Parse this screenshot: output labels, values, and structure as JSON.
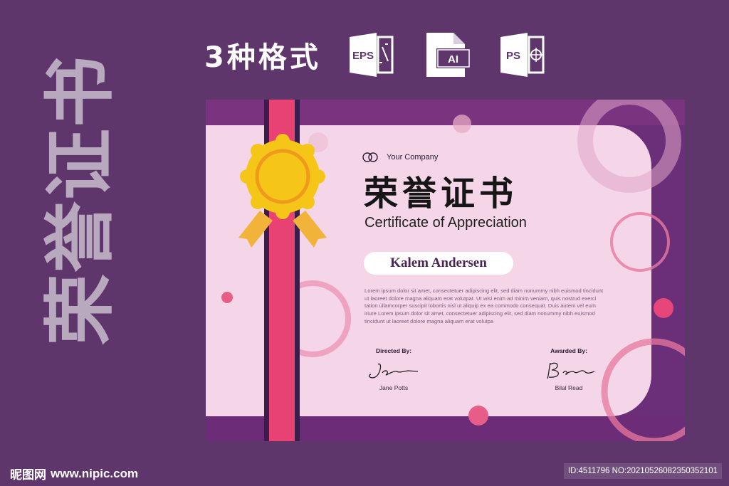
{
  "side_title_chars": [
    "荣",
    "誉",
    "证",
    "书"
  ],
  "formats": {
    "label": "3种格式",
    "icons": [
      {
        "name": "eps-file-icon",
        "text": "EPS"
      },
      {
        "name": "ai-file-icon",
        "text": "AI"
      },
      {
        "name": "ps-file-icon",
        "text": "PS"
      }
    ]
  },
  "certificate": {
    "company": "Your Company",
    "title_cn": "荣誉证书",
    "title_en": "Certificate of Appreciation",
    "recipient": "Kalem Andersen",
    "body": "Lorem ipsum dolor sit amet, consectetuer adipiscing elit, sed diam nonummy nibh euismod tincidunt ut laoreet dolore magna aliquam erat volutpat. Ut wisi enim ad minim veniam, quis nostrud exerci tation ullamcorper suscipit lobortis nisl ut aliquip ex ea commodo consequat. Duis autem vel eum iriure Lorem ipsum dolor sit amet, consectetuer adipiscing elit, sed diam nonummy nibh euismod tincidunt ut laoreet dolore magna aliquam erat volutpa",
    "signatures": [
      {
        "label": "Directed By:",
        "name": "Jane Potts"
      },
      {
        "label": "Awarded By:",
        "name": "Bilal Read"
      }
    ]
  },
  "footer": {
    "logo_cn": "昵图网",
    "logo_url": "www.nipic.com",
    "id_text": "ID:4511796 NO:20210526082350352101"
  },
  "colors": {
    "background": "#5e366b",
    "panel": "#f4d6e8",
    "ribbon": "#e84174",
    "seal": "#f5c518",
    "accent": "#e8457a"
  }
}
